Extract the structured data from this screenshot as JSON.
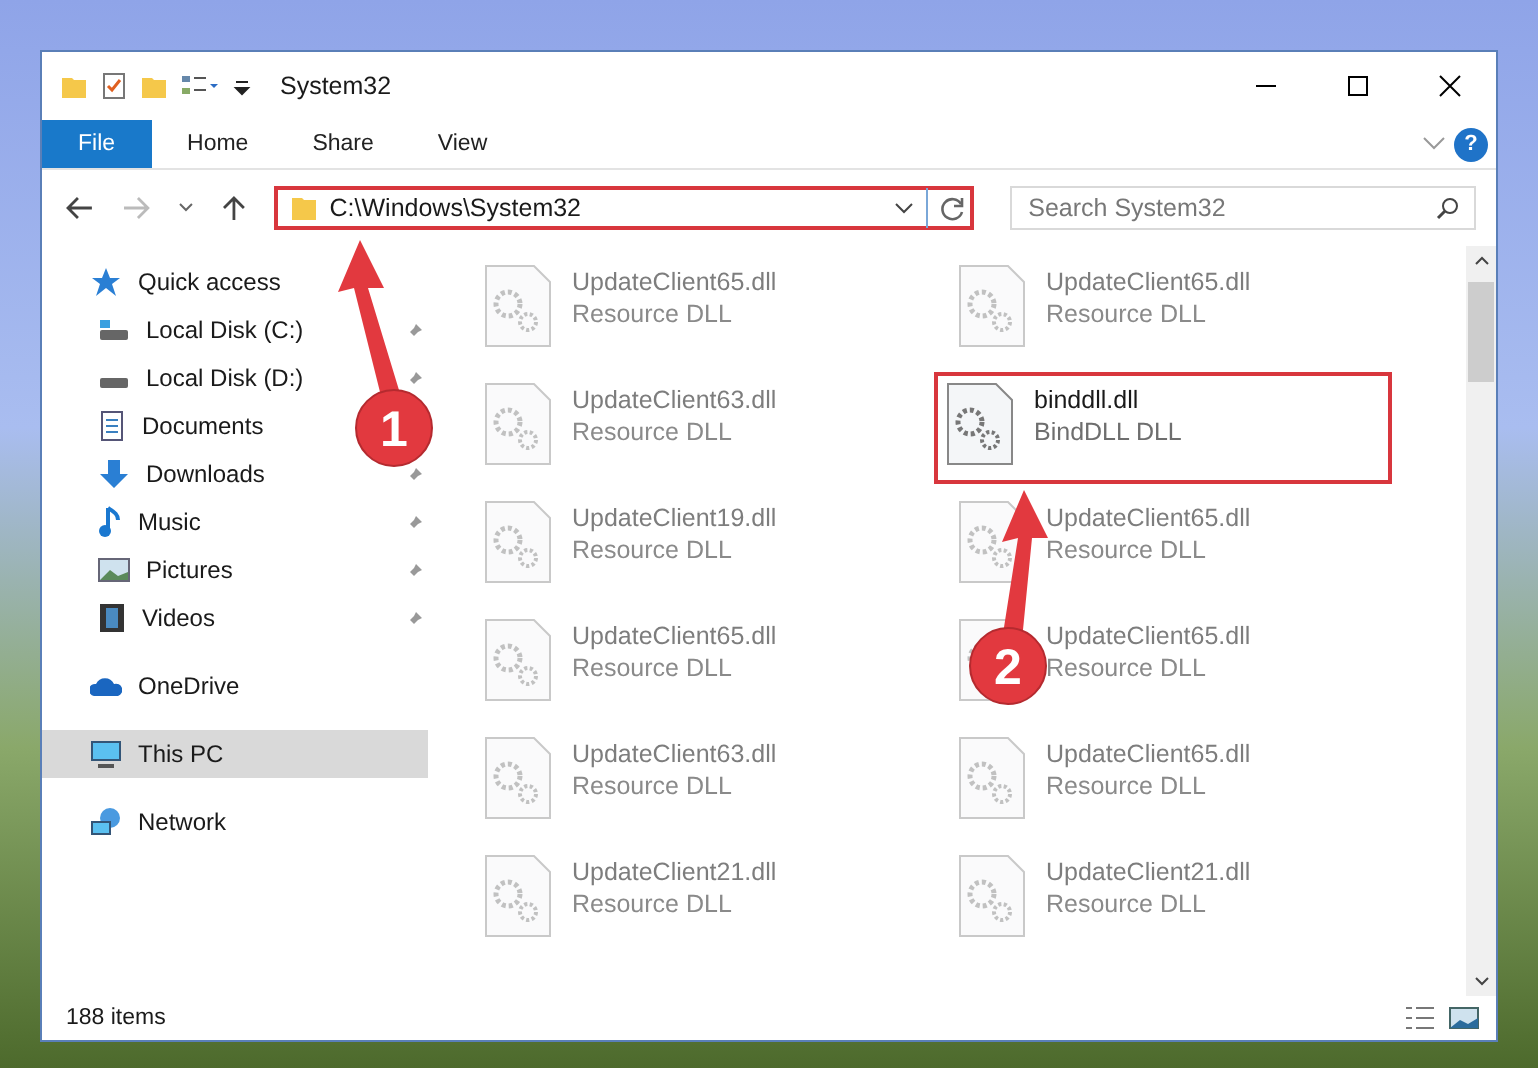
{
  "window": {
    "title": "System32"
  },
  "ribbon_tabs": [
    {
      "label": "File",
      "selected": true
    },
    {
      "label": "Home",
      "selected": false
    },
    {
      "label": "Share",
      "selected": false
    },
    {
      "label": "View",
      "selected": false
    }
  ],
  "help_button": {
    "label": "?"
  },
  "address_bar": {
    "path": "C:\\Windows\\System32",
    "highlighted": true
  },
  "search": {
    "placeholder": "Search System32"
  },
  "navigation": [
    {
      "label": "Quick access",
      "kind": "star",
      "selected": false,
      "children": [
        {
          "label": "Local Disk (C:)",
          "kind": "drive",
          "pinned": true
        },
        {
          "label": "Local Disk (D:)",
          "kind": "drive",
          "pinned": true
        },
        {
          "label": "Documents",
          "kind": "documents",
          "pinned": false
        },
        {
          "label": "Downloads",
          "kind": "downloads",
          "pinned": true
        },
        {
          "label": "Music",
          "kind": "music",
          "pinned": true
        },
        {
          "label": "Pictures",
          "kind": "pictures",
          "pinned": true
        },
        {
          "label": "Videos",
          "kind": "videos",
          "pinned": true
        }
      ]
    },
    {
      "label": "OneDrive",
      "kind": "cloud",
      "selected": false
    },
    {
      "label": "This PC",
      "kind": "computer",
      "selected": true
    },
    {
      "label": "Network",
      "kind": "network",
      "selected": false
    }
  ],
  "files": [
    {
      "name": "UpdateClient65.dll",
      "type": "Resource DLL",
      "dimmed": true,
      "highlighted": false
    },
    {
      "name": "UpdateClient65.dll",
      "type": "Resource DLL",
      "dimmed": true,
      "highlighted": false
    },
    {
      "name": "UpdateClient63.dll",
      "type": "Resource DLL",
      "dimmed": true,
      "highlighted": false
    },
    {
      "name": "binddll.dll",
      "type": "BindDLL DLL",
      "dimmed": false,
      "highlighted": true
    },
    {
      "name": "UpdateClient19.dll",
      "type": "Resource DLL",
      "dimmed": true,
      "highlighted": false
    },
    {
      "name": "UpdateClient65.dll",
      "type": "Resource DLL",
      "dimmed": true,
      "highlighted": false
    },
    {
      "name": "UpdateClient65.dll",
      "type": "Resource DLL",
      "dimmed": true,
      "highlighted": false
    },
    {
      "name": "UpdateClient65.dll",
      "type": "Resource DLL",
      "dimmed": true,
      "highlighted": false
    },
    {
      "name": "UpdateClient63.dll",
      "type": "Resource DLL",
      "dimmed": true,
      "highlighted": false
    },
    {
      "name": "UpdateClient65.dll",
      "type": "Resource DLL",
      "dimmed": true,
      "highlighted": false
    },
    {
      "name": "UpdateClient21.dll",
      "type": "Resource DLL",
      "dimmed": true,
      "highlighted": false
    },
    {
      "name": "UpdateClient21.dll",
      "type": "Resource DLL",
      "dimmed": true,
      "highlighted": false
    }
  ],
  "status_bar": {
    "item_count": "188 items"
  },
  "callouts": [
    {
      "number": "1"
    },
    {
      "number": "2"
    }
  ]
}
